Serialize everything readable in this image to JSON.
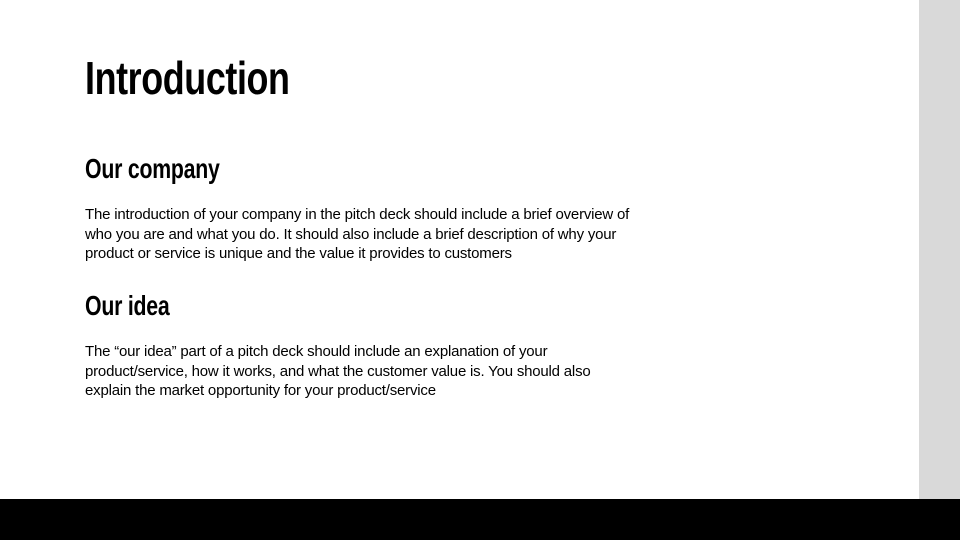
{
  "slide": {
    "title": "Introduction",
    "sections": [
      {
        "heading": "Our company",
        "lines": [
          "The introduction of your company in the pitch deck should include a brief overview of",
          "who you are and what you do. It should also include a brief description of why your",
          "product or service is unique and the value it provides to customers"
        ]
      },
      {
        "heading": "Our idea",
        "lines": [
          "The “our idea” part of a pitch deck should include an explanation of your",
          "product/service, how it works, and what the customer value is. You should also",
          "explain the market opportunity for your product/service"
        ]
      }
    ]
  },
  "colors": {
    "background": "#ffffff",
    "side_panel": "#d9d9d9",
    "bottom_bar": "#000000",
    "text": "#000000"
  }
}
